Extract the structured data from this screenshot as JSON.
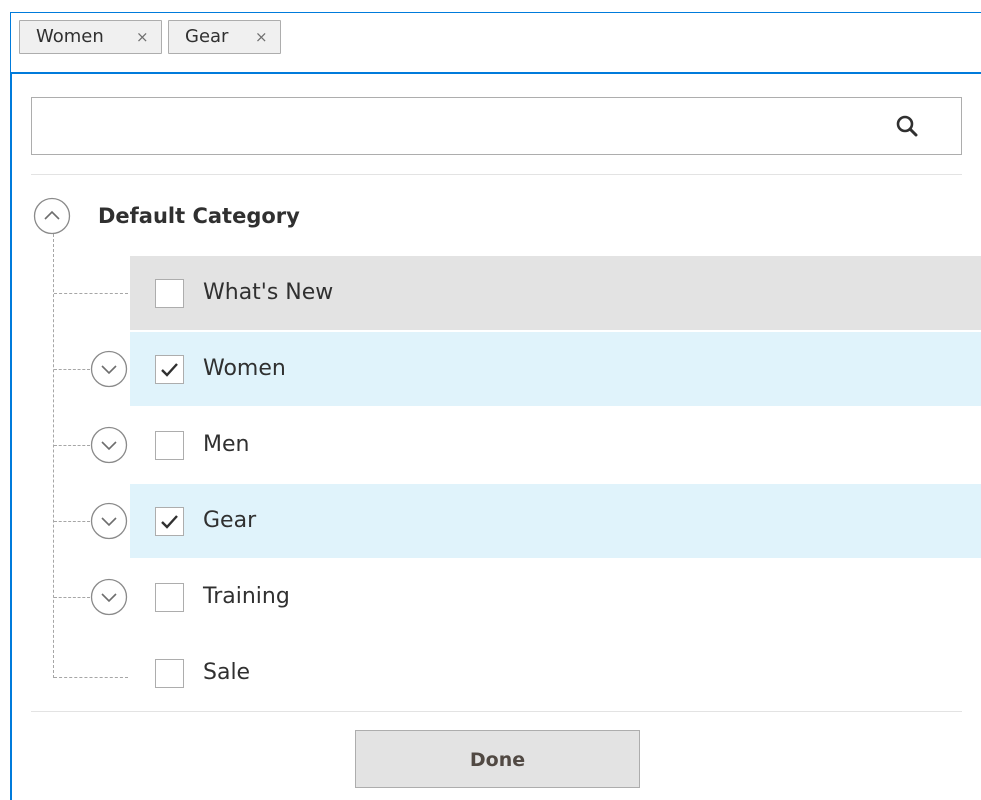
{
  "selected_tags": [
    {
      "label": "Women",
      "remove_glyph": "×"
    },
    {
      "label": "Gear",
      "remove_glyph": "×"
    }
  ],
  "search": {
    "value": "",
    "placeholder": "",
    "icon": "search-icon"
  },
  "tree": {
    "root": {
      "label": "Default Category",
      "expanded": true,
      "toggle_icon": "chevron-up-icon"
    },
    "items": [
      {
        "label": "What's New",
        "checked": false,
        "has_children": false,
        "state": "hover"
      },
      {
        "label": "Women",
        "checked": true,
        "has_children": true,
        "state": "selected"
      },
      {
        "label": "Men",
        "checked": false,
        "has_children": true,
        "state": "normal"
      },
      {
        "label": "Gear",
        "checked": true,
        "has_children": true,
        "state": "selected"
      },
      {
        "label": "Training",
        "checked": false,
        "has_children": true,
        "state": "normal"
      },
      {
        "label": "Sale",
        "checked": false,
        "has_children": false,
        "state": "normal"
      }
    ]
  },
  "actions": {
    "done_label": "Done"
  },
  "colors": {
    "accent": "#007bdb",
    "selected_row": "#e0f3fb",
    "hover_row": "#e3e3e3",
    "button_bg": "#e3e3e3"
  }
}
